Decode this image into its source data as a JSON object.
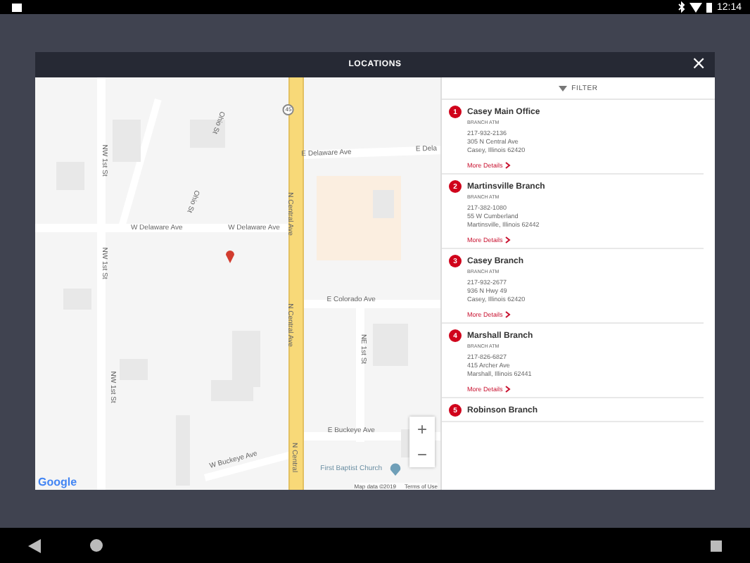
{
  "status_bar": {
    "time": "12:14"
  },
  "dialog": {
    "title": "LOCATIONS",
    "close": "×"
  },
  "map": {
    "labels": [
      {
        "kind": "h",
        "text": "E Delaware Ave"
      },
      {
        "kind": "h",
        "text": "E Dela"
      },
      {
        "kind": "h",
        "text": "W Delaware Ave"
      },
      {
        "kind": "h",
        "text": "W Delaware Ave"
      },
      {
        "kind": "v",
        "text": "NW 1st St"
      },
      {
        "kind": "v",
        "text": "NW 1st St"
      },
      {
        "kind": "v",
        "text": "NW 1st St"
      },
      {
        "kind": "v",
        "text": "Ohio St"
      },
      {
        "kind": "v",
        "text": "Ohio St"
      },
      {
        "kind": "v",
        "text": "N Central Ave"
      },
      {
        "kind": "v",
        "text": "N Central Ave"
      },
      {
        "kind": "v",
        "text": "N Central"
      },
      {
        "kind": "h",
        "text": "E Colorado Ave"
      },
      {
        "kind": "v",
        "text": "NE 1st St"
      },
      {
        "kind": "h",
        "text": "E Buckeye Ave"
      },
      {
        "kind": "h",
        "text": "W Buckeye Ave"
      },
      {
        "kind": "poi",
        "text": "First Baptist Church"
      },
      {
        "kind": "shield",
        "text": "45"
      }
    ],
    "attribution": "Map data ©2019",
    "terms": "Terms of Use",
    "logo": "Google",
    "zoom_in": "+",
    "zoom_out": "−"
  },
  "list": {
    "filter": "FILTER",
    "items": [
      {
        "number": "1",
        "name": "Casey Main Office",
        "type": "BRANCH ATM",
        "phone": "217-932-2136",
        "address": "305 N Central Ave",
        "city": "Casey, Illinois 62420",
        "link": "More Details"
      },
      {
        "number": "2",
        "name": "Martinsville Branch",
        "type": "BRANCH ATM",
        "phone": "217-382-1080",
        "address": "55 W Cumberland",
        "city": "Martinsville, Illinois 62442",
        "link": "More Details"
      },
      {
        "number": "3",
        "name": "Casey Branch",
        "type": "BRANCH ATM",
        "phone": "217-932-2677",
        "address": "936 N Hwy 49",
        "city": "Casey, Illinois 62420",
        "link": "More Details"
      },
      {
        "number": "4",
        "name": "Marshall Branch",
        "type": "BRANCH ATM",
        "phone": "217-826-6827",
        "address": "415 Archer Ave",
        "city": "Marshall, Illinois 62441",
        "link": "More Details"
      },
      {
        "number": "5",
        "name": "Robinson Branch"
      }
    ]
  }
}
